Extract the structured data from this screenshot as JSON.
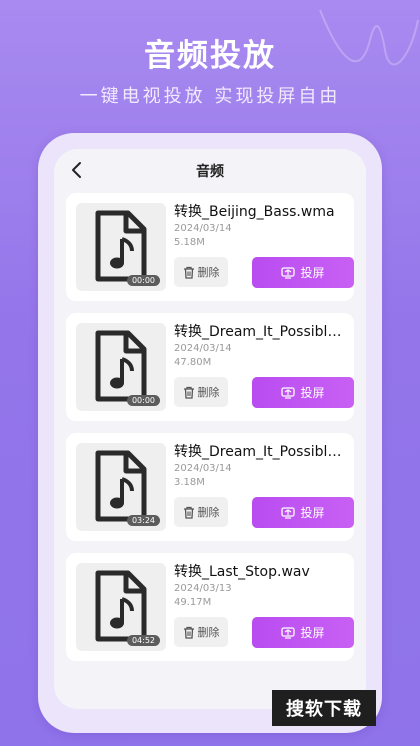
{
  "hero": {
    "title": "音频投放",
    "subtitle": "一键电视投放 实现投屏自由"
  },
  "nav": {
    "title": "音频",
    "back_icon": "chevron-left-icon"
  },
  "files": [
    {
      "name": "转换_Beijing_Bass.wma",
      "date": "2024/03/14",
      "size": "5.18M",
      "duration": "00:00",
      "delete_label": "删除",
      "cast_label": "投屏"
    },
    {
      "name": "转换_Dream_It_Possible.w...",
      "date": "2024/03/14",
      "size": "47.80M",
      "duration": "00:00",
      "delete_label": "删除",
      "cast_label": "投屏"
    },
    {
      "name": "转换_Dream_It_Possible.aac",
      "date": "2024/03/14",
      "size": "3.18M",
      "duration": "03:24",
      "delete_label": "删除",
      "cast_label": "投屏"
    },
    {
      "name": "转换_Last_Stop.wav",
      "date": "2024/03/13",
      "size": "49.17M",
      "duration": "04:52",
      "delete_label": "删除",
      "cast_label": "投屏"
    }
  ],
  "watermark": "搜软下载",
  "colors": {
    "background": "#9475ea",
    "accent": "#c060f2"
  }
}
